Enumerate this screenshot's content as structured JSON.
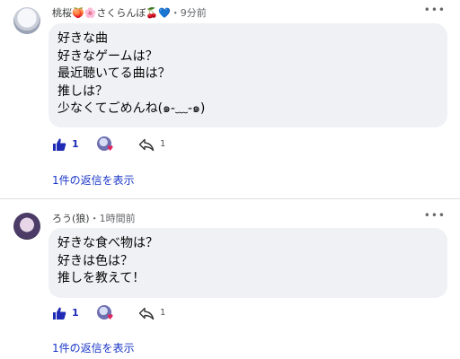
{
  "comments": [
    {
      "author": "桃桜🍑🌸さくらんぼ🍒💙",
      "separator": "・",
      "time": "9分前",
      "more_icon": "more-horizontal-icon",
      "lines": [
        "好きな曲",
        "好きなゲームは？",
        "最近聴いてる曲は？",
        "推しは？",
        "少なくてごめんね(๑-﹏-๑)"
      ],
      "like_count": "1",
      "reply_count": "1",
      "replies_link": "1件の返信を表示"
    },
    {
      "author": "ろう(狼)",
      "separator": "・",
      "time": "1時間前",
      "more_icon": "more-horizontal-icon",
      "lines": [
        "好きな食べ物は？",
        "好きは色は？",
        "推しを教えて！"
      ],
      "like_count": "1",
      "reply_count": "1",
      "replies_link": "1件の返信を表示"
    }
  ],
  "colors": {
    "accent": "#1f2bb5",
    "link": "#1a36c8",
    "bubble": "#eff1f4",
    "heart": "#e0245e"
  },
  "icons": {
    "like": "thumbs-up-icon",
    "reply": "reply-arrow-icon",
    "more": "more-horizontal-icon",
    "heart": "heart-icon"
  }
}
